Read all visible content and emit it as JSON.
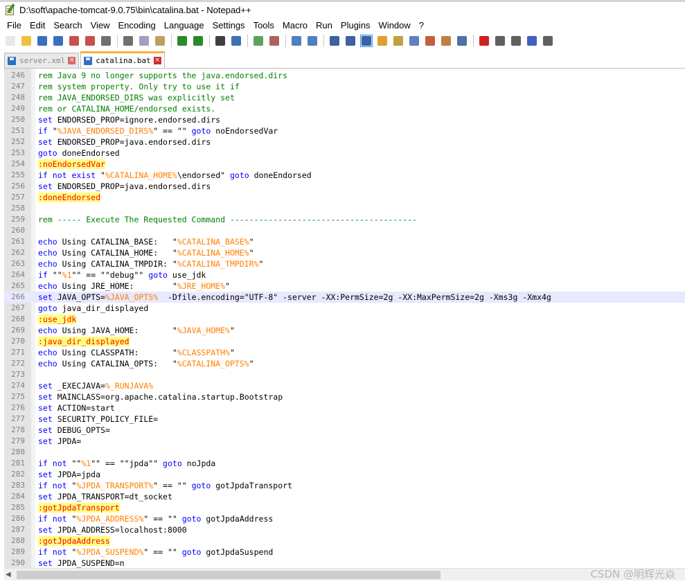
{
  "window": {
    "title": "D:\\soft\\apache-tomcat-9.0.75\\bin\\catalina.bat - Notepad++"
  },
  "menu": [
    "File",
    "Edit",
    "Search",
    "View",
    "Encoding",
    "Language",
    "Settings",
    "Tools",
    "Macro",
    "Run",
    "Plugins",
    "Window",
    "?"
  ],
  "toolbar": [
    {
      "name": "new-file-icon",
      "color": "#e8e8e8"
    },
    {
      "name": "open-file-icon",
      "color": "#f0c040"
    },
    {
      "name": "save-icon",
      "color": "#3a6fc0"
    },
    {
      "name": "save-all-icon",
      "color": "#3a6fc0"
    },
    {
      "name": "close-file-icon",
      "color": "#c85050"
    },
    {
      "name": "close-all-icon",
      "color": "#c85050"
    },
    {
      "name": "print-icon",
      "color": "#707070"
    },
    {
      "sep": true
    },
    {
      "name": "cut-icon",
      "color": "#707070"
    },
    {
      "name": "copy-icon",
      "color": "#a0a0c0"
    },
    {
      "name": "paste-icon",
      "color": "#c0a060"
    },
    {
      "sep": true
    },
    {
      "name": "undo-icon",
      "color": "#2a8a2a"
    },
    {
      "name": "redo-icon",
      "color": "#2a8a2a"
    },
    {
      "sep": true
    },
    {
      "name": "find-icon",
      "color": "#404040"
    },
    {
      "name": "replace-icon",
      "color": "#4070b0"
    },
    {
      "sep": true
    },
    {
      "name": "zoom-in-icon",
      "color": "#60a060"
    },
    {
      "name": "zoom-out-icon",
      "color": "#b06060"
    },
    {
      "sep": true
    },
    {
      "name": "sync-vertical-icon",
      "color": "#5080c0"
    },
    {
      "name": "sync-horizontal-icon",
      "color": "#5080c0"
    },
    {
      "sep": true
    },
    {
      "name": "word-wrap-icon",
      "color": "#4060a0"
    },
    {
      "name": "show-all-chars-icon",
      "color": "#4060a0"
    },
    {
      "name": "indent-guide-icon",
      "color": "#4060a0",
      "active": true
    },
    {
      "name": "language-define-icon",
      "color": "#e0a030"
    },
    {
      "name": "document-map-icon",
      "color": "#c0a040"
    },
    {
      "name": "function-list-icon",
      "color": "#6080c0"
    },
    {
      "name": "folder-as-workspace-icon",
      "color": "#c06040"
    },
    {
      "name": "monitoring-icon",
      "color": "#c08040"
    },
    {
      "name": "eye-icon",
      "color": "#5070a0"
    },
    {
      "sep": true
    },
    {
      "name": "record-macro-icon",
      "color": "#d02020"
    },
    {
      "name": "stop-recording-icon",
      "color": "#606060"
    },
    {
      "name": "playback-macro-icon",
      "color": "#606060"
    },
    {
      "name": "run-macro-multiple-icon",
      "color": "#4060c0"
    },
    {
      "name": "save-macro-icon",
      "color": "#606060"
    }
  ],
  "tabs": [
    {
      "label": "server.xml",
      "active": false
    },
    {
      "label": "catalina.bat",
      "active": true
    }
  ],
  "code": [
    {
      "n": "246",
      "t": [
        [
          "c",
          "rem Java 9 no longer supports the java.endorsed.dirs"
        ]
      ]
    },
    {
      "n": "247",
      "t": [
        [
          "c",
          "rem system property. Only try to use it if"
        ]
      ]
    },
    {
      "n": "248",
      "t": [
        [
          "c",
          "rem JAVA_ENDORSED_DIRS was explicitly set"
        ]
      ]
    },
    {
      "n": "249",
      "t": [
        [
          "c",
          "rem or CATALINA_HOME/endorsed exists."
        ]
      ]
    },
    {
      "n": "250",
      "t": [
        [
          "k",
          "set"
        ],
        [
          "x",
          " ENDORSED_PROP=ignore.endorsed.dirs"
        ]
      ]
    },
    {
      "n": "251",
      "t": [
        [
          "k",
          "if"
        ],
        [
          "x",
          " \""
        ],
        [
          "v",
          "%JAVA_ENDORSED_DIRS%"
        ],
        [
          "x",
          "\" == \"\" "
        ],
        [
          "k",
          "goto"
        ],
        [
          "x",
          " noEndorsedVar"
        ]
      ]
    },
    {
      "n": "252",
      "t": [
        [
          "k",
          "set"
        ],
        [
          "x",
          " ENDORSED_PROP=java.endorsed.dirs"
        ]
      ]
    },
    {
      "n": "253",
      "t": [
        [
          "k",
          "goto"
        ],
        [
          "x",
          " doneEndorsed"
        ]
      ]
    },
    {
      "n": "254",
      "t": [
        [
          "l",
          ":noEndorsedVar"
        ]
      ]
    },
    {
      "n": "255",
      "t": [
        [
          "k",
          "if not exist"
        ],
        [
          "x",
          " \""
        ],
        [
          "v",
          "%CATALINA_HOME%"
        ],
        [
          "x",
          "\\endorsed\" "
        ],
        [
          "k",
          "goto"
        ],
        [
          "x",
          " doneEndorsed"
        ]
      ]
    },
    {
      "n": "256",
      "t": [
        [
          "k",
          "set"
        ],
        [
          "x",
          " ENDORSED_PROP=java.endorsed.dirs"
        ]
      ]
    },
    {
      "n": "257",
      "t": [
        [
          "l",
          ":doneEndorsed"
        ]
      ]
    },
    {
      "n": "258",
      "t": []
    },
    {
      "n": "259",
      "t": [
        [
          "c",
          "rem ----- Execute The Requested Command ---------------------------------------"
        ]
      ]
    },
    {
      "n": "260",
      "t": []
    },
    {
      "n": "261",
      "t": [
        [
          "k",
          "echo"
        ],
        [
          "x",
          " Using CATALINA_BASE:   \""
        ],
        [
          "v",
          "%CATALINA_BASE%"
        ],
        [
          "x",
          "\""
        ]
      ]
    },
    {
      "n": "262",
      "t": [
        [
          "k",
          "echo"
        ],
        [
          "x",
          " Using CATALINA_HOME:   \""
        ],
        [
          "v",
          "%CATALINA_HOME%"
        ],
        [
          "x",
          "\""
        ]
      ]
    },
    {
      "n": "263",
      "t": [
        [
          "k",
          "echo"
        ],
        [
          "x",
          " Using CATALINA_TMPDIR: \""
        ],
        [
          "v",
          "%CATALINA_TMPDIR%"
        ],
        [
          "x",
          "\""
        ]
      ]
    },
    {
      "n": "264",
      "t": [
        [
          "k",
          "if"
        ],
        [
          "x",
          " \"\""
        ],
        [
          "v",
          "%1"
        ],
        [
          "x",
          "\"\" == \"\"debug\"\" "
        ],
        [
          "k",
          "goto"
        ],
        [
          "x",
          " use_jdk"
        ]
      ]
    },
    {
      "n": "265",
      "t": [
        [
          "k",
          "echo"
        ],
        [
          "x",
          " Using JRE_HOME:        \""
        ],
        [
          "v",
          "%JRE_HOME%"
        ],
        [
          "x",
          "\""
        ]
      ]
    },
    {
      "n": "266",
      "current": true,
      "t": [
        [
          "k",
          "set"
        ],
        [
          "x",
          " JAVA_OPTS="
        ],
        [
          "v",
          "%JAVA_OPTS%"
        ],
        [
          "x",
          "  -Dfile.encoding=\"UTF-8\" -server -XX:PermSize=2g -XX:MaxPermSize=2g -Xms3g -Xmx4g"
        ]
      ]
    },
    {
      "n": "267",
      "t": [
        [
          "k",
          "goto"
        ],
        [
          "x",
          " java_dir_displayed"
        ]
      ]
    },
    {
      "n": "268",
      "t": [
        [
          "l",
          ":use_jdk"
        ]
      ]
    },
    {
      "n": "269",
      "t": [
        [
          "k",
          "echo"
        ],
        [
          "x",
          " Using JAVA_HOME:       \""
        ],
        [
          "v",
          "%JAVA_HOME%"
        ],
        [
          "x",
          "\""
        ]
      ]
    },
    {
      "n": "270",
      "t": [
        [
          "l",
          ":java_dir_displayed"
        ]
      ]
    },
    {
      "n": "271",
      "t": [
        [
          "k",
          "echo"
        ],
        [
          "x",
          " Using CLASSPATH:       \""
        ],
        [
          "v",
          "%CLASSPATH%"
        ],
        [
          "x",
          "\""
        ]
      ]
    },
    {
      "n": "272",
      "t": [
        [
          "k",
          "echo"
        ],
        [
          "x",
          " Using CATALINA_OPTS:   \""
        ],
        [
          "v",
          "%CATALINA_OPTS%"
        ],
        [
          "x",
          "\""
        ]
      ]
    },
    {
      "n": "273",
      "t": []
    },
    {
      "n": "274",
      "t": [
        [
          "k",
          "set"
        ],
        [
          "x",
          " _EXECJAVA="
        ],
        [
          "v",
          "%_RUNJAVA%"
        ]
      ]
    },
    {
      "n": "275",
      "t": [
        [
          "k",
          "set"
        ],
        [
          "x",
          " MAINCLASS=org.apache.catalina.startup.Bootstrap"
        ]
      ]
    },
    {
      "n": "276",
      "t": [
        [
          "k",
          "set"
        ],
        [
          "x",
          " ACTION=start"
        ]
      ]
    },
    {
      "n": "277",
      "t": [
        [
          "k",
          "set"
        ],
        [
          "x",
          " SECURITY_POLICY_FILE="
        ]
      ]
    },
    {
      "n": "278",
      "t": [
        [
          "k",
          "set"
        ],
        [
          "x",
          " DEBUG_OPTS="
        ]
      ]
    },
    {
      "n": "279",
      "t": [
        [
          "k",
          "set"
        ],
        [
          "x",
          " JPDA="
        ]
      ]
    },
    {
      "n": "280",
      "t": []
    },
    {
      "n": "281",
      "t": [
        [
          "k",
          "if not"
        ],
        [
          "x",
          " \"\""
        ],
        [
          "v",
          "%1"
        ],
        [
          "x",
          "\"\" == \"\"jpda\"\" "
        ],
        [
          "k",
          "goto"
        ],
        [
          "x",
          " noJpda"
        ]
      ]
    },
    {
      "n": "282",
      "t": [
        [
          "k",
          "set"
        ],
        [
          "x",
          " JPDA=jpda"
        ]
      ]
    },
    {
      "n": "283",
      "t": [
        [
          "k",
          "if not"
        ],
        [
          "x",
          " \""
        ],
        [
          "v",
          "%JPDA_TRANSPORT%"
        ],
        [
          "x",
          "\" == \"\" "
        ],
        [
          "k",
          "goto"
        ],
        [
          "x",
          " gotJpdaTransport"
        ]
      ]
    },
    {
      "n": "284",
      "t": [
        [
          "k",
          "set"
        ],
        [
          "x",
          " JPDA_TRANSPORT=dt_socket"
        ]
      ]
    },
    {
      "n": "285",
      "t": [
        [
          "l",
          ":gotJpdaTransport"
        ]
      ]
    },
    {
      "n": "286",
      "t": [
        [
          "k",
          "if not"
        ],
        [
          "x",
          " \""
        ],
        [
          "v",
          "%JPDA_ADDRESS%"
        ],
        [
          "x",
          "\" == \"\" "
        ],
        [
          "k",
          "goto"
        ],
        [
          "x",
          " gotJpdaAddress"
        ]
      ]
    },
    {
      "n": "287",
      "t": [
        [
          "k",
          "set"
        ],
        [
          "x",
          " JPDA_ADDRESS=localhost:8000"
        ]
      ]
    },
    {
      "n": "288",
      "t": [
        [
          "l",
          ":gotJpdaAddress"
        ]
      ]
    },
    {
      "n": "289",
      "t": [
        [
          "k",
          "if not"
        ],
        [
          "x",
          " \""
        ],
        [
          "v",
          "%JPDA_SUSPEND%"
        ],
        [
          "x",
          "\" == \"\" "
        ],
        [
          "k",
          "goto"
        ],
        [
          "x",
          " gotJpdaSuspend"
        ]
      ]
    },
    {
      "n": "290",
      "t": [
        [
          "k",
          "set"
        ],
        [
          "x",
          " JPDA_SUSPEND=n"
        ]
      ]
    }
  ],
  "watermark": "CSDN @明辉光焱",
  "scroll": {
    "left_arrow": "◀"
  }
}
